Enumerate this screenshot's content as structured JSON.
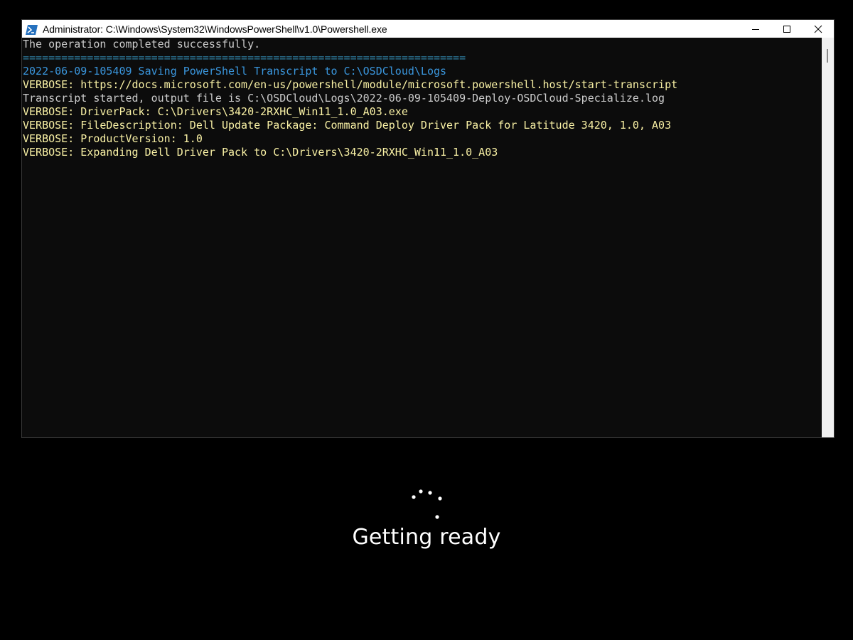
{
  "window": {
    "title": "Administrator: C:\\Windows\\System32\\WindowsPowerShell\\v1.0\\Powershell.exe",
    "app_icon": "powershell-icon",
    "controls": [
      "minimize-icon",
      "maximize-icon",
      "close-icon"
    ]
  },
  "console": {
    "lines": [
      {
        "text": "The operation completed successfully.",
        "color": "#cccccc"
      },
      {
        "text": "=====================================================================",
        "color": "#2e7fa3"
      },
      {
        "text": "2022-06-09-105409 Saving PowerShell Transcript to C:\\OSDCloud\\Logs",
        "color": "#3a96dd"
      },
      {
        "text": "VERBOSE: https://docs.microsoft.com/en-us/powershell/module/microsoft.powershell.host/start-transcript",
        "color": "#f9f1a5"
      },
      {
        "text": "Transcript started, output file is C:\\OSDCloud\\Logs\\2022-06-09-105409-Deploy-OSDCloud-Specialize.log",
        "color": "#cccccc"
      },
      {
        "text": "VERBOSE: DriverPack: C:\\Drivers\\3420-2RXHC_Win11_1.0_A03.exe",
        "color": "#f9f1a5"
      },
      {
        "text": "VERBOSE: FileDescription: Dell Update Package: Command Deploy Driver Pack for Latitude 3420, 1.0, A03",
        "color": "#f9f1a5"
      },
      {
        "text": "VERBOSE: ProductVersion: 1.0",
        "color": "#f9f1a5"
      },
      {
        "text": "VERBOSE: Expanding Dell Driver Pack to C:\\Drivers\\3420-2RXHC_Win11_1.0_A03",
        "color": "#f9f1a5"
      }
    ]
  },
  "status": {
    "spinner_icon": "loading-spinner-icon",
    "text": "Getting ready"
  }
}
